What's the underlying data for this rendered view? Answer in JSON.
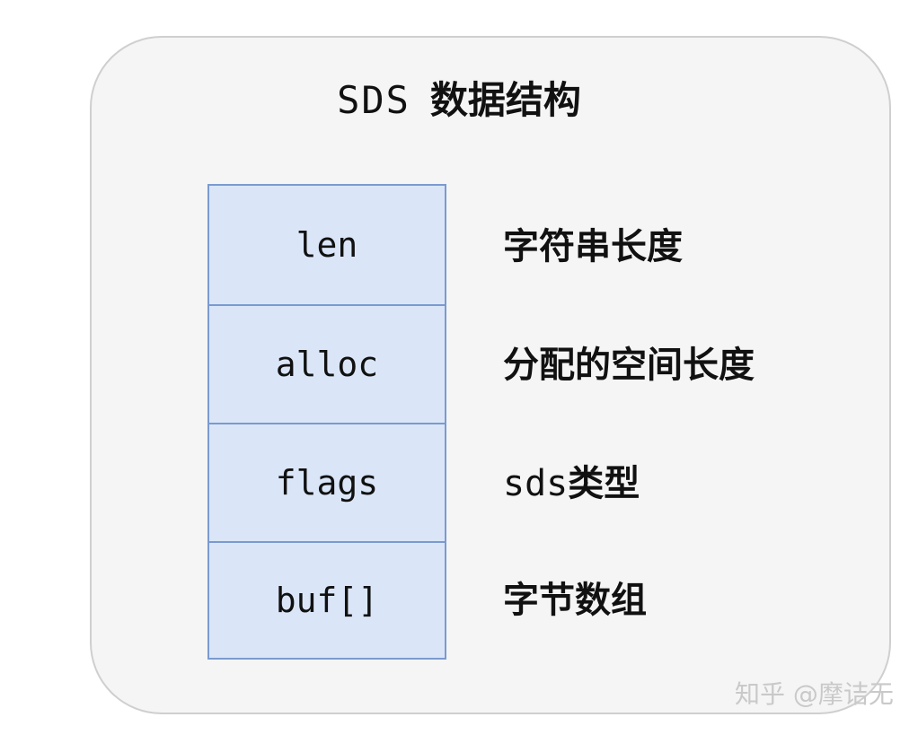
{
  "diagram": {
    "title_code": "SDS",
    "title_text": "数据结构",
    "fields": [
      {
        "name": "len",
        "desc": "字符串长度"
      },
      {
        "name": "alloc",
        "desc": "分配的空间长度"
      },
      {
        "name": "flags",
        "desc_prefix": "sds",
        "desc": "类型"
      },
      {
        "name": "buf[]",
        "desc": "字节数组"
      }
    ]
  },
  "watermark": "知乎 @摩诘无",
  "colors": {
    "card_bg": "#f5f5f5",
    "card_border": "#cfcfcf",
    "field_fill": "#dae6f8",
    "field_border": "#7a9ad0"
  }
}
